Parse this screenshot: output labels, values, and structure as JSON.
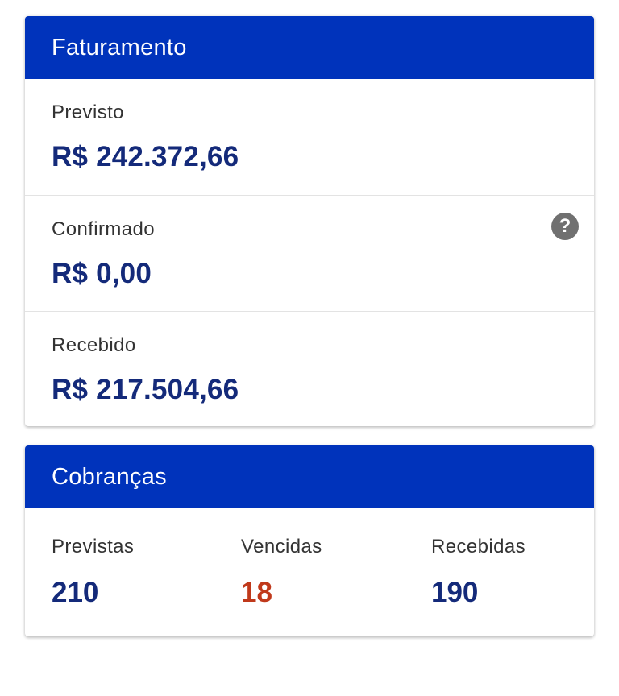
{
  "faturamento": {
    "title": "Faturamento",
    "previsto": {
      "label": "Previsto",
      "value": "R$ 242.372,66"
    },
    "confirmado": {
      "label": "Confirmado",
      "value": "R$ 0,00",
      "help_icon": "?"
    },
    "recebido": {
      "label": "Recebido",
      "value": "R$ 217.504,66"
    }
  },
  "cobrancas": {
    "title": "Cobranças",
    "previstas": {
      "label": "Previstas",
      "value": "210"
    },
    "vencidas": {
      "label": "Vencidas",
      "value": "18"
    },
    "recebidas": {
      "label": "Recebidas",
      "value": "190"
    }
  },
  "colors": {
    "header_bg": "#0033bb",
    "value_blue": "#142a7a",
    "overdue_red": "#c0391b"
  },
  "icons": {
    "help": "question-circle-icon"
  }
}
